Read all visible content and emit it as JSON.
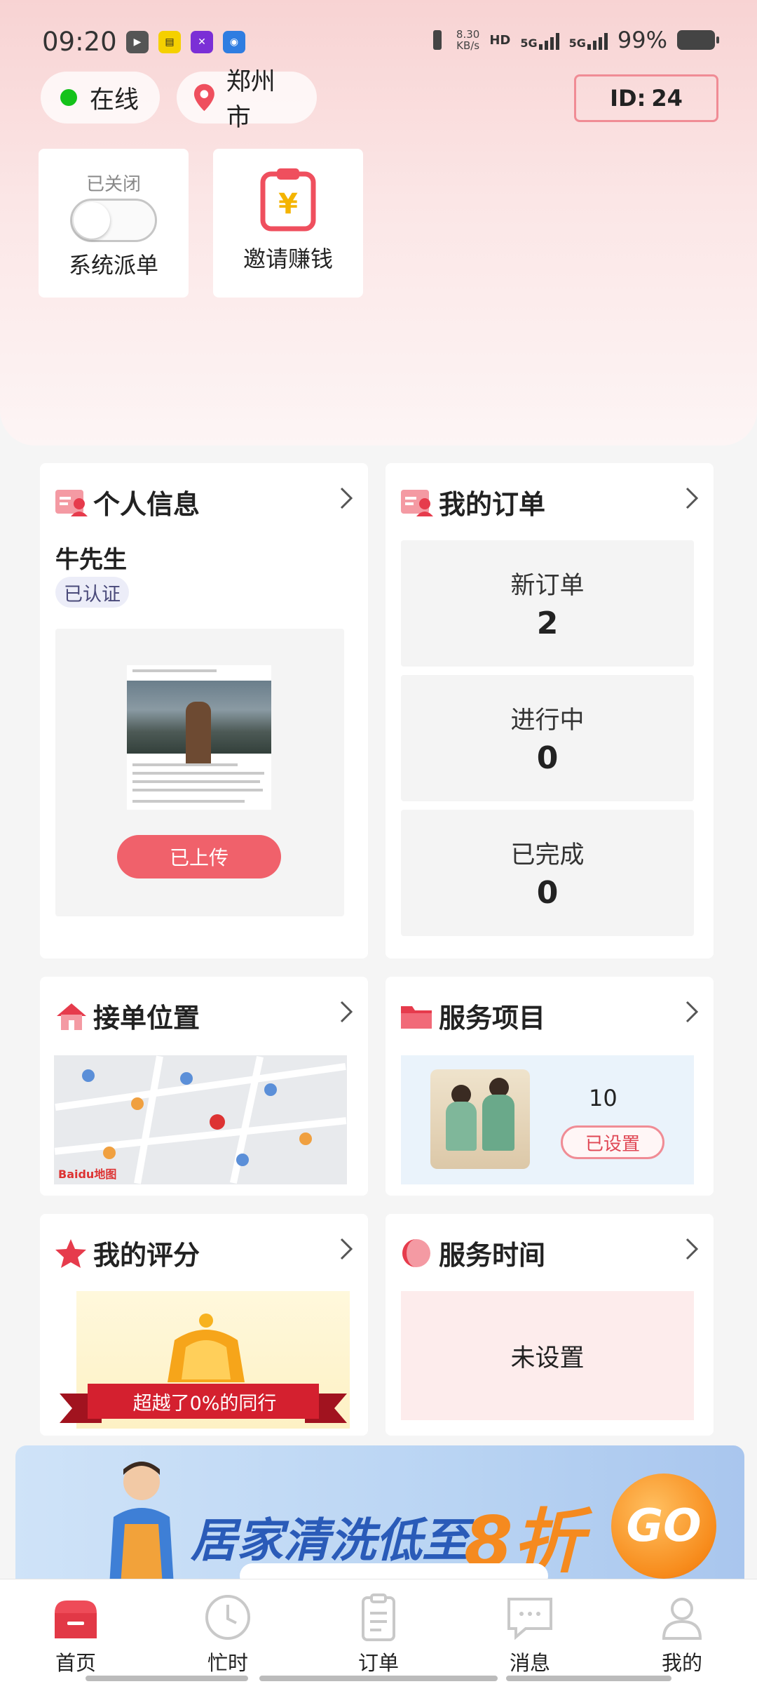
{
  "status_bar": {
    "time": "09:20",
    "net_speed_value": "8.30",
    "net_speed_unit": "KB/s",
    "hd_label": "HD",
    "sim1_label": "5G",
    "sim2_label": "5G",
    "battery_percent": "99%"
  },
  "header": {
    "online_label": "在线",
    "city_label": "郑州市",
    "id_prefix": "ID:",
    "id_value": "24"
  },
  "quick_tiles": {
    "dispatch_status": "已关闭",
    "dispatch_label": "系统派单",
    "dispatch_enabled": false,
    "invite_label": "邀请赚钱"
  },
  "personal_info": {
    "title": "个人信息",
    "name": "牛先生",
    "verified_label": "已认证",
    "upload_button": "已上传"
  },
  "my_orders": {
    "title": "我的订单",
    "items": [
      {
        "label": "新订单",
        "count": "2"
      },
      {
        "label": "进行中",
        "count": "0"
      },
      {
        "label": "已完成",
        "count": "0"
      }
    ]
  },
  "location": {
    "title": "接单位置",
    "map_brand": "Baidu地图"
  },
  "service_items": {
    "title": "服务项目",
    "count": "10",
    "status_button": "已设置"
  },
  "rating": {
    "title": "我的评分",
    "ribbon_text": "超越了0%的同行"
  },
  "service_time": {
    "title": "服务时间",
    "value": "未设置"
  },
  "banner": {
    "text": "居家清洗低至",
    "discount": "8折",
    "go": "GO"
  },
  "tabbar": {
    "items": [
      {
        "label": "首页",
        "active": true
      },
      {
        "label": "忙时",
        "active": false
      },
      {
        "label": "订单",
        "active": false
      },
      {
        "label": "消息",
        "active": false
      },
      {
        "label": "我的",
        "active": false
      }
    ]
  },
  "colors": {
    "accent": "#f0616b",
    "online_green": "#14c21a",
    "header_gradient_top": "#f8d3d3"
  }
}
